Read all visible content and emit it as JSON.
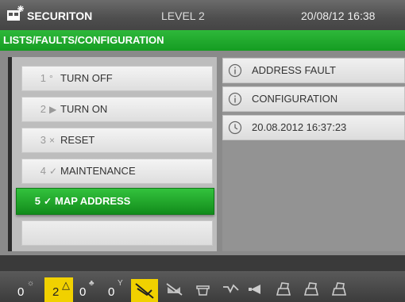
{
  "header": {
    "brand": "SECURITON",
    "level": "LEVEL 2",
    "datetime": "20/08/12 16:38"
  },
  "breadcrumb": "LISTS/FAULTS/CONFIGURATION",
  "menu": {
    "items": [
      {
        "num": "1",
        "glyph": "°",
        "label": "TURN OFF"
      },
      {
        "num": "2",
        "glyph": "▶",
        "label": "TURN ON"
      },
      {
        "num": "3",
        "glyph": "×",
        "label": "RESET"
      },
      {
        "num": "4",
        "glyph": "✓",
        "label": "MAINTENANCE"
      },
      {
        "num": "5",
        "glyph": "✓",
        "label": "MAP ADDRESS"
      }
    ],
    "selected_index": 4
  },
  "details": {
    "rows": [
      {
        "icon": "info-icon",
        "text": "ADDRESS FAULT"
      },
      {
        "icon": "info-icon",
        "text": "CONFIGURATION"
      },
      {
        "icon": "clock-icon",
        "text": "20.08.2012 16:37:23"
      }
    ]
  },
  "iconbar": {
    "counters": [
      {
        "value": "0",
        "symbol": "☼",
        "icon": "fire-alarm-icon"
      },
      {
        "value": "2",
        "symbol": "△",
        "icon": "fault-warning-icon",
        "active": true
      },
      {
        "value": "0",
        "symbol": "♣",
        "icon": "pre-alarm-icon"
      },
      {
        "value": "0",
        "symbol": "Y",
        "icon": "technical-alarm-icon"
      }
    ],
    "tools": [
      "turned-off-detector-icon",
      "turned-off-sirens-icon",
      "maintenance-icon",
      "test-icon",
      "horn-silenced-icon",
      "print-icon",
      "print-icon",
      "print-icon"
    ],
    "colors": {
      "active": "#f1d100",
      "accent_green": "#1fa82b"
    }
  }
}
